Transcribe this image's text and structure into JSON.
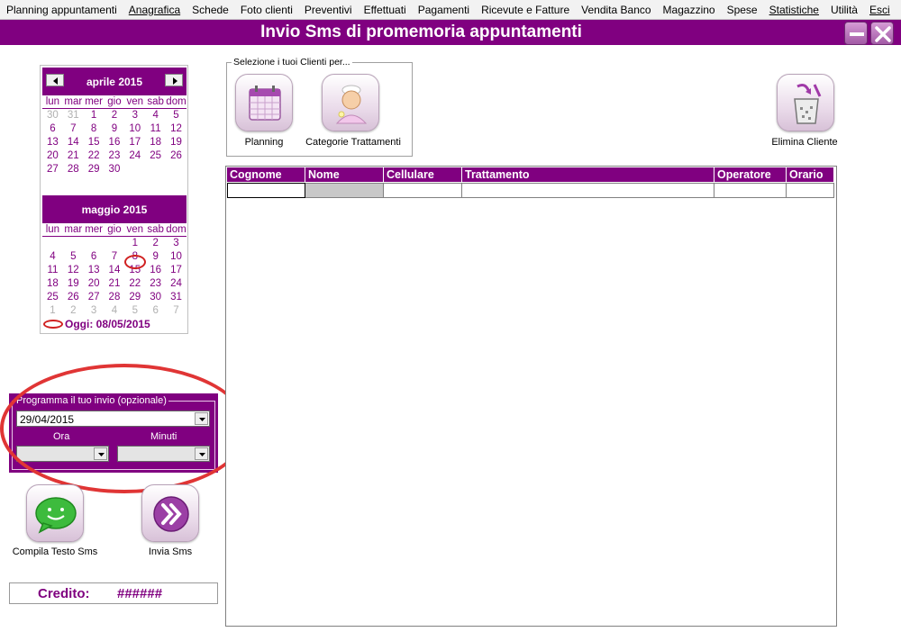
{
  "menu": [
    {
      "label": "Planning appuntamenti",
      "underline": false
    },
    {
      "label": "Anagrafica",
      "underline": true
    },
    {
      "label": "Schede",
      "underline": false
    },
    {
      "label": "Foto clienti",
      "underline": false
    },
    {
      "label": "Preventivi",
      "underline": false
    },
    {
      "label": "Effettuati",
      "underline": false
    },
    {
      "label": "Pagamenti",
      "underline": false
    },
    {
      "label": "Ricevute e Fatture",
      "underline": false
    },
    {
      "label": "Vendita Banco",
      "underline": false
    },
    {
      "label": "Magazzino",
      "underline": false
    },
    {
      "label": "Spese",
      "underline": false
    },
    {
      "label": "Statistiche",
      "underline": true
    },
    {
      "label": "Utilità",
      "underline": false
    },
    {
      "label": "Esci",
      "underline": true
    }
  ],
  "window": {
    "title": "Invio Sms di promemoria appuntamenti",
    "minimize_icon": "minimize-icon",
    "close_icon": "close-icon",
    "accent": "#800080"
  },
  "calendar": {
    "weekdays": [
      "lun",
      "mar",
      "mer",
      "gio",
      "ven",
      "sab",
      "dom"
    ],
    "months": [
      {
        "title": "aprile 2015",
        "weeks": [
          [
            {
              "d": "30",
              "o": true
            },
            {
              "d": "31",
              "o": true
            },
            {
              "d": "1"
            },
            {
              "d": "2"
            },
            {
              "d": "3"
            },
            {
              "d": "4"
            },
            {
              "d": "5"
            }
          ],
          [
            {
              "d": "6"
            },
            {
              "d": "7"
            },
            {
              "d": "8"
            },
            {
              "d": "9"
            },
            {
              "d": "10"
            },
            {
              "d": "11"
            },
            {
              "d": "12"
            }
          ],
          [
            {
              "d": "13"
            },
            {
              "d": "14"
            },
            {
              "d": "15"
            },
            {
              "d": "16"
            },
            {
              "d": "17"
            },
            {
              "d": "18"
            },
            {
              "d": "19"
            }
          ],
          [
            {
              "d": "20"
            },
            {
              "d": "21"
            },
            {
              "d": "22"
            },
            {
              "d": "23"
            },
            {
              "d": "24"
            },
            {
              "d": "25"
            },
            {
              "d": "26"
            }
          ],
          [
            {
              "d": "27"
            },
            {
              "d": "28"
            },
            {
              "d": "29"
            },
            {
              "d": "30"
            },
            {
              "d": ""
            },
            {
              "d": ""
            },
            {
              "d": ""
            }
          ]
        ]
      },
      {
        "title": "maggio 2015",
        "weeks": [
          [
            {
              "d": ""
            },
            {
              "d": ""
            },
            {
              "d": ""
            },
            {
              "d": ""
            },
            {
              "d": "1"
            },
            {
              "d": "2"
            },
            {
              "d": "3"
            }
          ],
          [
            {
              "d": "4"
            },
            {
              "d": "5"
            },
            {
              "d": "6"
            },
            {
              "d": "7"
            },
            {
              "d": "8"
            },
            {
              "d": "9"
            },
            {
              "d": "10"
            }
          ],
          [
            {
              "d": "11"
            },
            {
              "d": "12"
            },
            {
              "d": "13"
            },
            {
              "d": "14"
            },
            {
              "d": "15"
            },
            {
              "d": "16"
            },
            {
              "d": "17"
            }
          ],
          [
            {
              "d": "18"
            },
            {
              "d": "19"
            },
            {
              "d": "20"
            },
            {
              "d": "21"
            },
            {
              "d": "22"
            },
            {
              "d": "23"
            },
            {
              "d": "24"
            }
          ],
          [
            {
              "d": "25"
            },
            {
              "d": "26"
            },
            {
              "d": "27"
            },
            {
              "d": "28"
            },
            {
              "d": "29"
            },
            {
              "d": "30"
            },
            {
              "d": "31"
            }
          ],
          [
            {
              "d": "1",
              "o": true
            },
            {
              "d": "2",
              "o": true
            },
            {
              "d": "3",
              "o": true
            },
            {
              "d": "4",
              "o": true
            },
            {
              "d": "5",
              "o": true
            },
            {
              "d": "6",
              "o": true
            },
            {
              "d": "7",
              "o": true
            }
          ]
        ]
      }
    ],
    "today_label": "Oggi: 08/05/2015"
  },
  "schedule": {
    "legend": "Programma il tuo invio (opzionale)",
    "date_value": "29/04/2015",
    "ora_label": "Ora",
    "minuti_label": "Minuti",
    "ora_value": "",
    "minuti_value": ""
  },
  "actions": {
    "compila_label": "Compila Testo Sms",
    "invia_label": "Invia Sms"
  },
  "credit": {
    "label": "Credito:",
    "value": "######"
  },
  "clients_group": {
    "legend": "Selezione i tuoi Clienti per...",
    "planning_label": "Planning",
    "categorie_label": "Categorie Trattamenti"
  },
  "elimina_label": "Elimina Cliente",
  "table": {
    "columns": [
      "Cognome",
      "Nome",
      "Cellulare",
      "Trattamento",
      "Operatore",
      "Orario"
    ],
    "rows": [
      [
        "",
        "",
        "",
        "",
        "",
        ""
      ]
    ]
  }
}
